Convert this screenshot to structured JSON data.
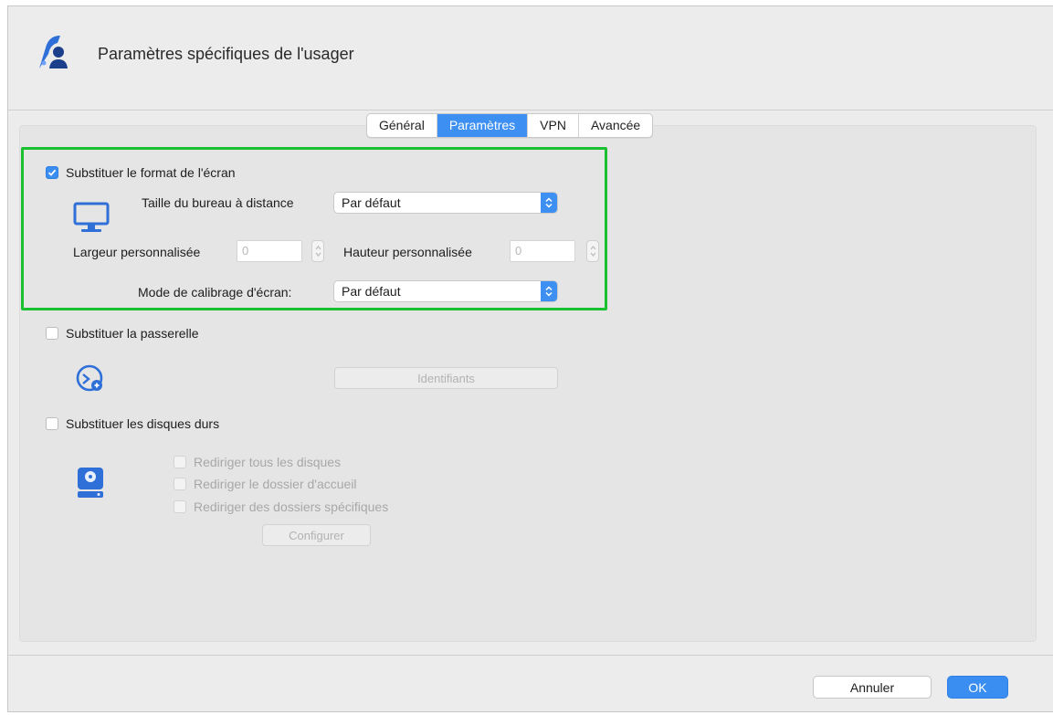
{
  "dialog": {
    "title": "Paramètres spécifiques de l'usager"
  },
  "tabs": [
    {
      "label": "Général",
      "active": false
    },
    {
      "label": "Paramètres",
      "active": true
    },
    {
      "label": "VPN",
      "active": false
    },
    {
      "label": "Avancée",
      "active": false
    }
  ],
  "display": {
    "override_label": "Substituer le format de l'écran",
    "override_checked": true,
    "desktop_size_label": "Taille du bureau à distance",
    "desktop_size_value": "Par défaut",
    "custom_width_label": "Largeur personnalisée",
    "custom_width_value": "0",
    "custom_height_label": "Hauteur personnalisée",
    "custom_height_value": "0",
    "scaling_mode_label": "Mode de calibrage d'écran:",
    "scaling_mode_value": "Par défaut"
  },
  "gateway": {
    "override_label": "Substituer la passerelle",
    "override_checked": false,
    "credentials_button": "Identifiants"
  },
  "drives": {
    "override_label": "Substituer les disques durs",
    "override_checked": false,
    "options": [
      "Rediriger tous les disques",
      "Rediriger le dossier d'accueil",
      "Rediriger des dossiers spécifiques"
    ],
    "configure_button": "Configurer"
  },
  "footer": {
    "cancel_label": "Annuler",
    "ok_label": "OK"
  },
  "colors": {
    "accent": "#3a8ef1",
    "highlight_border": "#19c02f"
  },
  "icons": {
    "title": "user-settings-icon",
    "display": "monitor-icon",
    "gateway": "gateway-icon",
    "drives": "hard-drive-icon"
  }
}
